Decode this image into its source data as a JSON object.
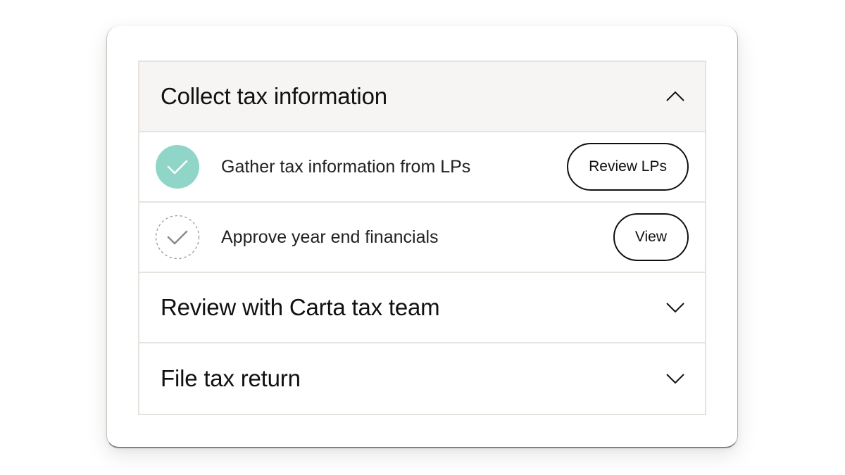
{
  "colors": {
    "accent": "#8fd6c8",
    "header_bg": "#f6f5f3",
    "divider": "#e6e3df"
  },
  "sections": [
    {
      "title": "Collect tax information",
      "state": "expanded",
      "chevron_icon": "chevron-up-icon",
      "tasks": [
        {
          "label": "Gather tax information from LPs",
          "status": "completed",
          "status_icon": "check-circle-filled-icon",
          "button_label": "Review LPs"
        },
        {
          "label": "Approve year end financials",
          "status": "pending",
          "status_icon": "check-circle-dashed-icon",
          "button_label": "View"
        }
      ]
    },
    {
      "title": "Review with Carta tax team",
      "state": "collapsed",
      "chevron_icon": "chevron-down-icon"
    },
    {
      "title": "File tax return",
      "state": "collapsed",
      "chevron_icon": "chevron-down-icon"
    }
  ]
}
